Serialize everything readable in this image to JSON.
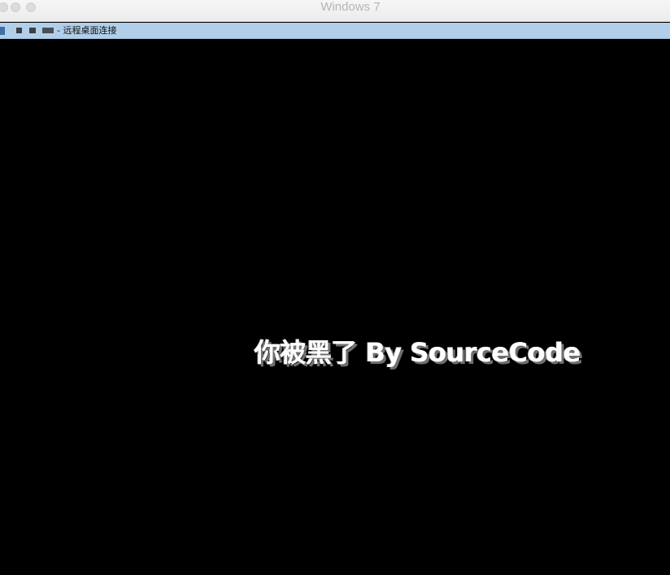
{
  "window": {
    "title": "Windows 7"
  },
  "rdp_bar": {
    "title": "- 远程桌面连接",
    "icon": "remote-desktop-icon"
  },
  "remote_screen": {
    "message": "你被黑了 By SourceCode",
    "background_color": "#000000",
    "text_color": "#ffffff"
  },
  "colors": {
    "rdp_bar_bg": "#b1cfe9",
    "mac_titlebar_bg": "#ececec"
  }
}
